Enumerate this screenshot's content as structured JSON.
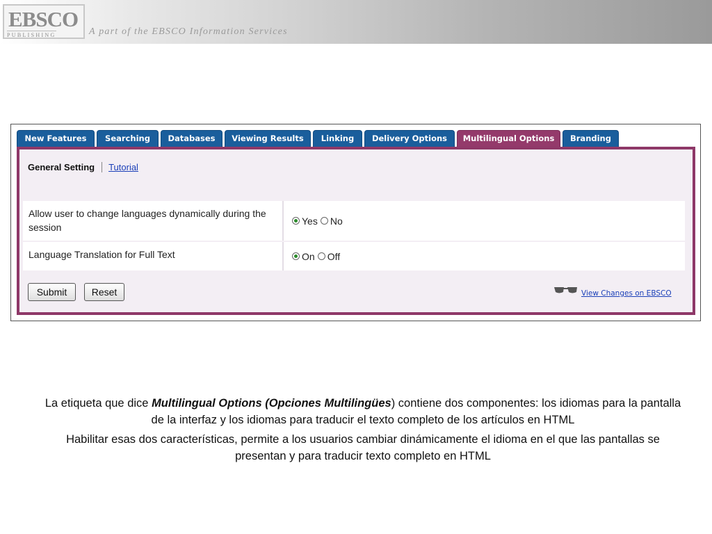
{
  "header": {
    "logo_text": "EBSCO",
    "logo_subtext": "PUBLISHING",
    "tagline": "A part of the EBSCO Information Services"
  },
  "tabs": [
    {
      "label": "New Features",
      "active": false
    },
    {
      "label": "Searching",
      "active": false
    },
    {
      "label": "Databases",
      "active": false
    },
    {
      "label": "Viewing Results",
      "active": false
    },
    {
      "label": "Linking",
      "active": false
    },
    {
      "label": "Delivery Options",
      "active": false
    },
    {
      "label": "Multilingual Options",
      "active": true
    },
    {
      "label": "Branding",
      "active": false
    }
  ],
  "subnav": {
    "general_setting": "General Setting",
    "tutorial": "Tutorial"
  },
  "settings": [
    {
      "label": "Allow user to change languages dynamically during the session",
      "options": [
        "Yes",
        "No"
      ],
      "selected": "Yes"
    },
    {
      "label": "Language Translation for Full Text",
      "options": [
        "On",
        "Off"
      ],
      "selected": "On"
    }
  ],
  "buttons": {
    "submit": "Submit",
    "reset": "Reset"
  },
  "view_changes_link": "View Changes on EBSCO",
  "colors": {
    "tab_blue": "#1a5e9c",
    "tab_active": "#943a6b",
    "panel_border": "#8e3868",
    "link": "#1a3fb8"
  },
  "caption": {
    "p1_before": "La etiqueta que dice ",
    "p1_bold": "Multilingual Options (Opciones Multilingües",
    "p1_after": ") contiene dos componentes: los idiomas para la pantalla de la interfaz y los idiomas para traducir el texto completo de los artículos en HTML",
    "p2": "Habilitar esas dos características, permite a los usuarios cambiar dinámicamente el idioma en el que las pantallas se presentan y para traducir texto completo en HTML"
  }
}
